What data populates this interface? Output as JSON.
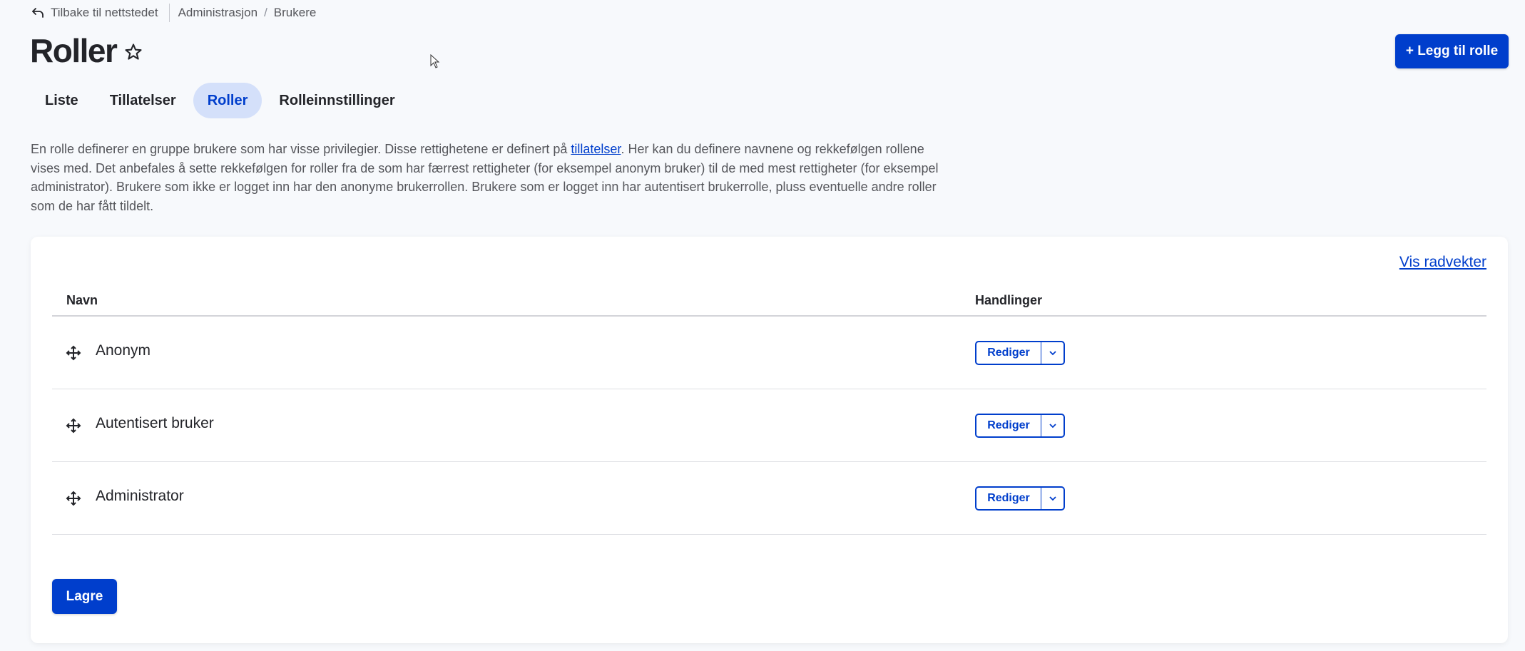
{
  "topbar": {
    "back_label": "Tilbake til nettstedet",
    "breadcrumb": [
      "Administrasjon",
      "Brukere"
    ],
    "separator": "/"
  },
  "page": {
    "title": "Roller",
    "add_button": "+ Legg til rolle"
  },
  "tabs": [
    {
      "label": "Liste",
      "active": false
    },
    {
      "label": "Tillatelser",
      "active": false
    },
    {
      "label": "Roller",
      "active": true
    },
    {
      "label": "Rolleinnstillinger",
      "active": false
    }
  ],
  "description": {
    "before_link": "En rolle definerer en gruppe brukere som har visse privilegier. Disse rettighetene er definert på ",
    "link": "tillatelser",
    "after_link": ". Her kan du definere navnene og rekkefølgen rol­lene vises med. Det anbefales å sette rekkefølgen for roller fra de som har færrest rettigheter (for eksempel anonym bruker) til de med mest rettigheter (for eksempel administrator). Brukere som ikke er logget inn har den anonyme brukerrollen. Brukere som er logget inn har autentisert brukerrolle, pluss eventuelle andre roller som de har fått tildelt."
  },
  "table": {
    "show_weights": "Vis radvekter",
    "headers": {
      "name": "Navn",
      "actions": "Handlinger"
    },
    "rows": [
      {
        "name": "Anonym",
        "action": "Rediger"
      },
      {
        "name": "Autentisert bruker",
        "action": "Rediger"
      },
      {
        "name": "Administrator",
        "action": "Rediger"
      }
    ]
  },
  "save_label": "Lagre",
  "colors": {
    "primary": "#003ecc",
    "active_tab_bg": "#d4e0fa",
    "background": "#f7f9fc"
  }
}
